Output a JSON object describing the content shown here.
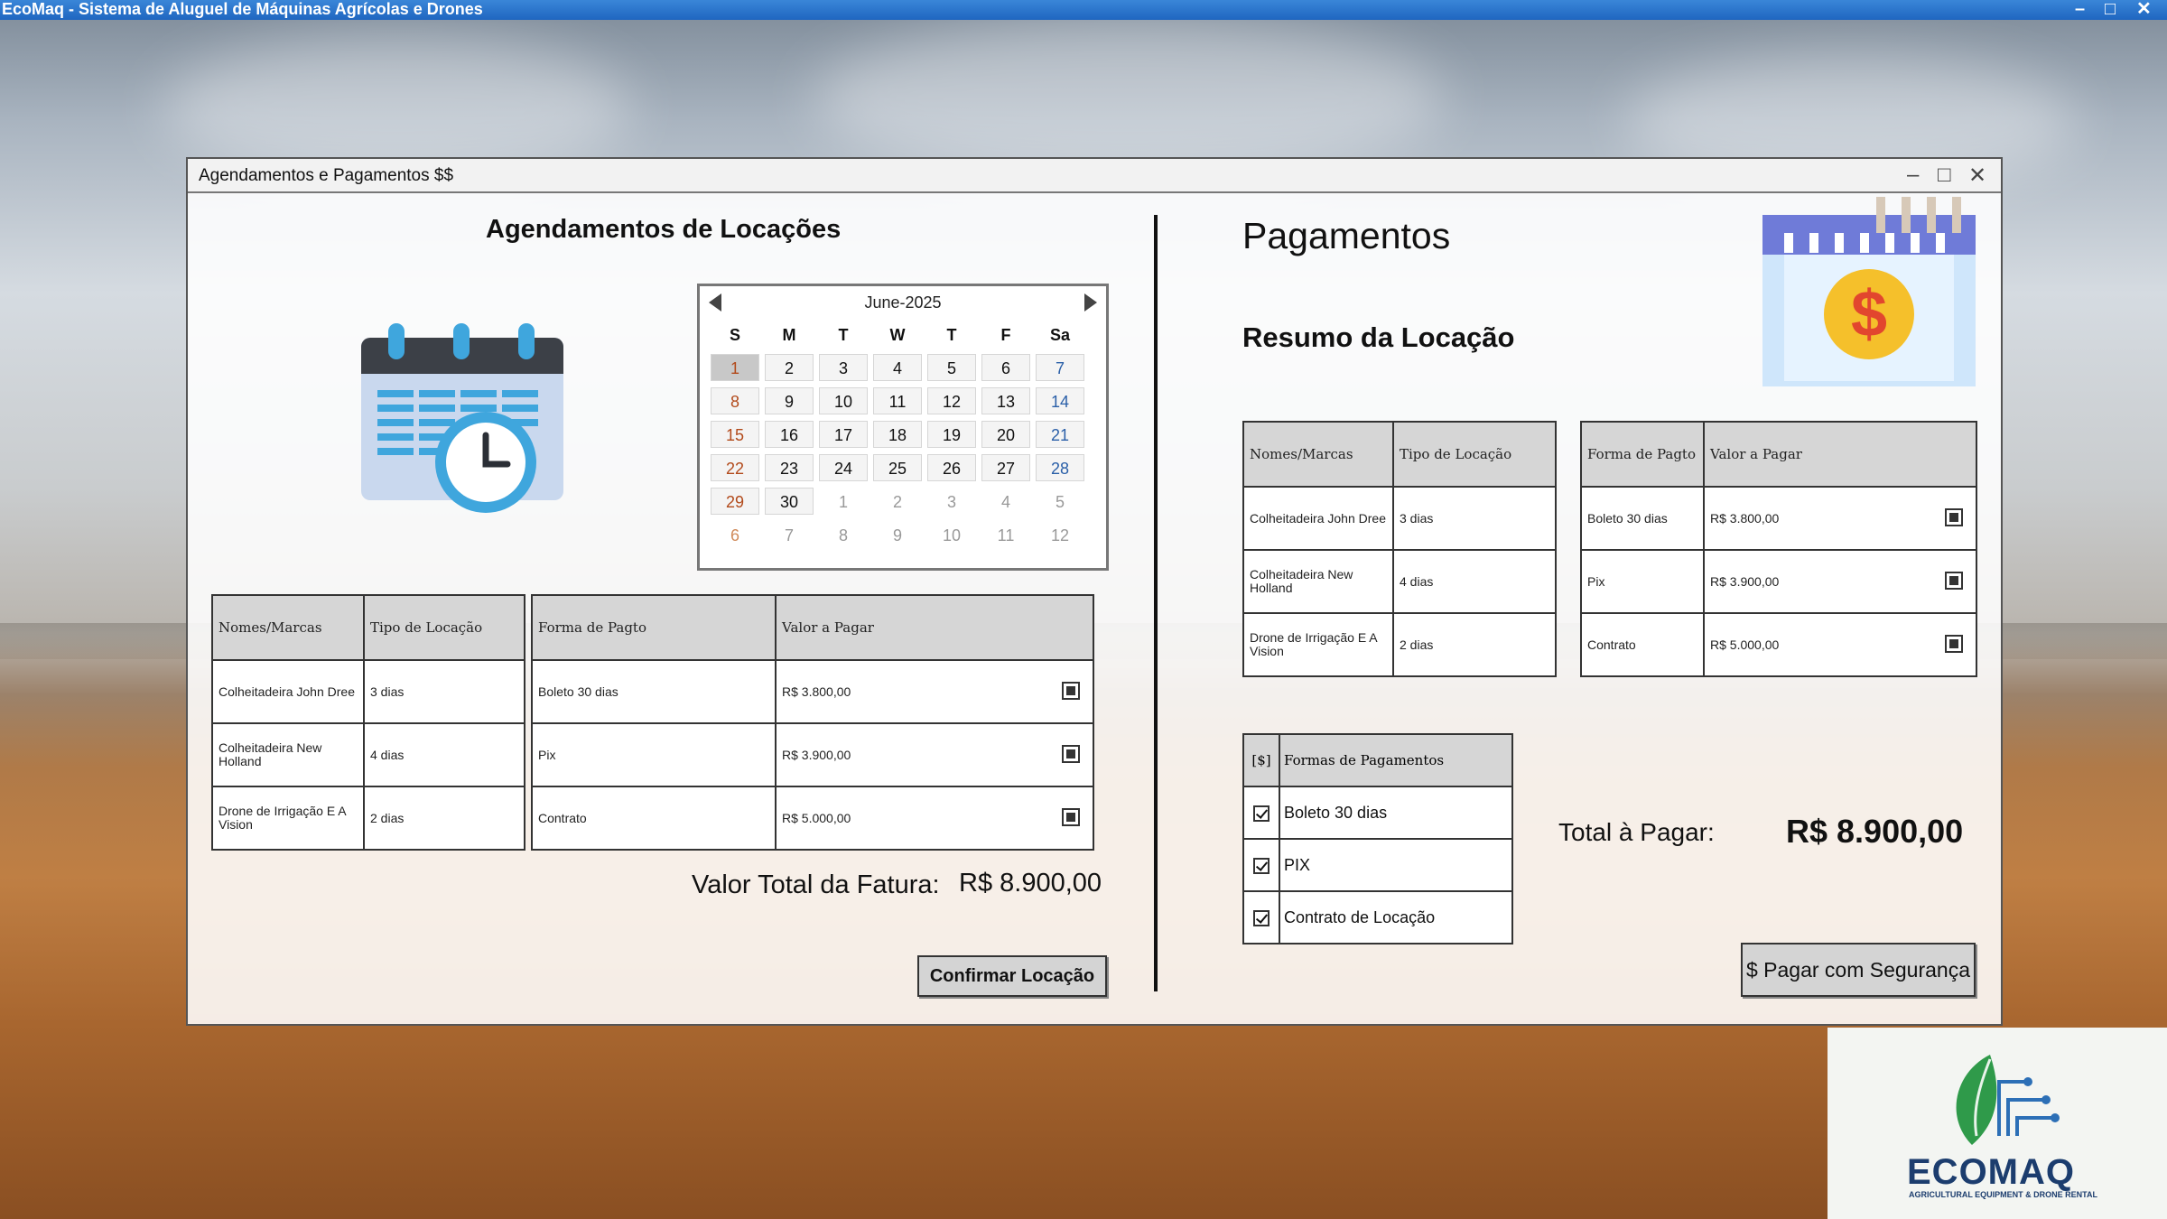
{
  "app": {
    "title": "EcoMaq - Sistema de Aluguel de Máquinas Agrícolas e Drones"
  },
  "window": {
    "title": "Agendamentos e Pagamentos $$"
  },
  "left": {
    "heading": "Agendamentos de Locações",
    "calendar": {
      "month": "June-2025",
      "day_headers": [
        "S",
        "M",
        "T",
        "W",
        "T",
        "F",
        "Sa"
      ],
      "selected_day": "1",
      "weeks": [
        [
          "1",
          "2",
          "3",
          "4",
          "5",
          "6",
          "7"
        ],
        [
          "8",
          "9",
          "10",
          "11",
          "12",
          "13",
          "14"
        ],
        [
          "15",
          "16",
          "17",
          "18",
          "19",
          "20",
          "21"
        ],
        [
          "22",
          "23",
          "24",
          "25",
          "26",
          "27",
          "28"
        ],
        [
          "29",
          "30",
          "1",
          "2",
          "3",
          "4",
          "5"
        ],
        [
          "6",
          "7",
          "8",
          "9",
          "10",
          "11",
          "12"
        ]
      ]
    },
    "table_a": {
      "headers": [
        "Nomes/Marcas",
        "Tipo de Locação"
      ],
      "rows": [
        [
          "Colheitadeira John Dree",
          "3 dias"
        ],
        [
          "Colheitadeira New Holland",
          "4 dias"
        ],
        [
          "Drone de Irrigação E A Vision",
          "2 dias"
        ]
      ]
    },
    "table_b": {
      "headers": [
        "Forma de Pagto",
        "Valor a Pagar"
      ],
      "rows": [
        [
          "Boleto 30 dias",
          "R$ 3.800,00"
        ],
        [
          "Pix",
          "R$ 3.900,00"
        ],
        [
          "Contrato",
          "R$ 5.000,00"
        ]
      ]
    },
    "total_label": "Valor Total da Fatura:",
    "total_value": "R$ 8.900,00",
    "confirm_button": "Confirmar Locação"
  },
  "right": {
    "heading": "Pagamentos",
    "subheading": "Resumo da Locação",
    "table_a": {
      "headers": [
        "Nomes/Marcas",
        "Tipo de Locação"
      ],
      "rows": [
        [
          "Colheitadeira John Dree",
          "3 dias"
        ],
        [
          "Colheitadeira New Holland",
          "4 dias"
        ],
        [
          "Drone de Irrigação E A Vision",
          "2 dias"
        ]
      ]
    },
    "table_b": {
      "headers": [
        "Forma de Pagto",
        "Valor a Pagar"
      ],
      "rows": [
        [
          "Boleto 30 dias",
          "R$ 3.800,00"
        ],
        [
          "Pix",
          "R$ 3.900,00"
        ],
        [
          "Contrato",
          "R$ 5.000,00"
        ]
      ]
    },
    "payment_methods": {
      "header_icon": "[$]",
      "header": "Formas de Pagamentos",
      "items": [
        "Boleto 30 dias",
        "PIX",
        "Contrato de Locação"
      ]
    },
    "total_label": "Total à Pagar:",
    "total_value": "R$ 8.900,00",
    "pay_button": "$ Pagar com Segurança"
  },
  "logo": {
    "name": "ECOMAQ",
    "tagline": "AGRICULTURAL EQUIPMENT & DRONE RENTAL"
  },
  "icons": [
    "calendar-clock-icon",
    "calendar-dollar-icon",
    "minimize-icon",
    "maximize-icon",
    "close-icon"
  ]
}
